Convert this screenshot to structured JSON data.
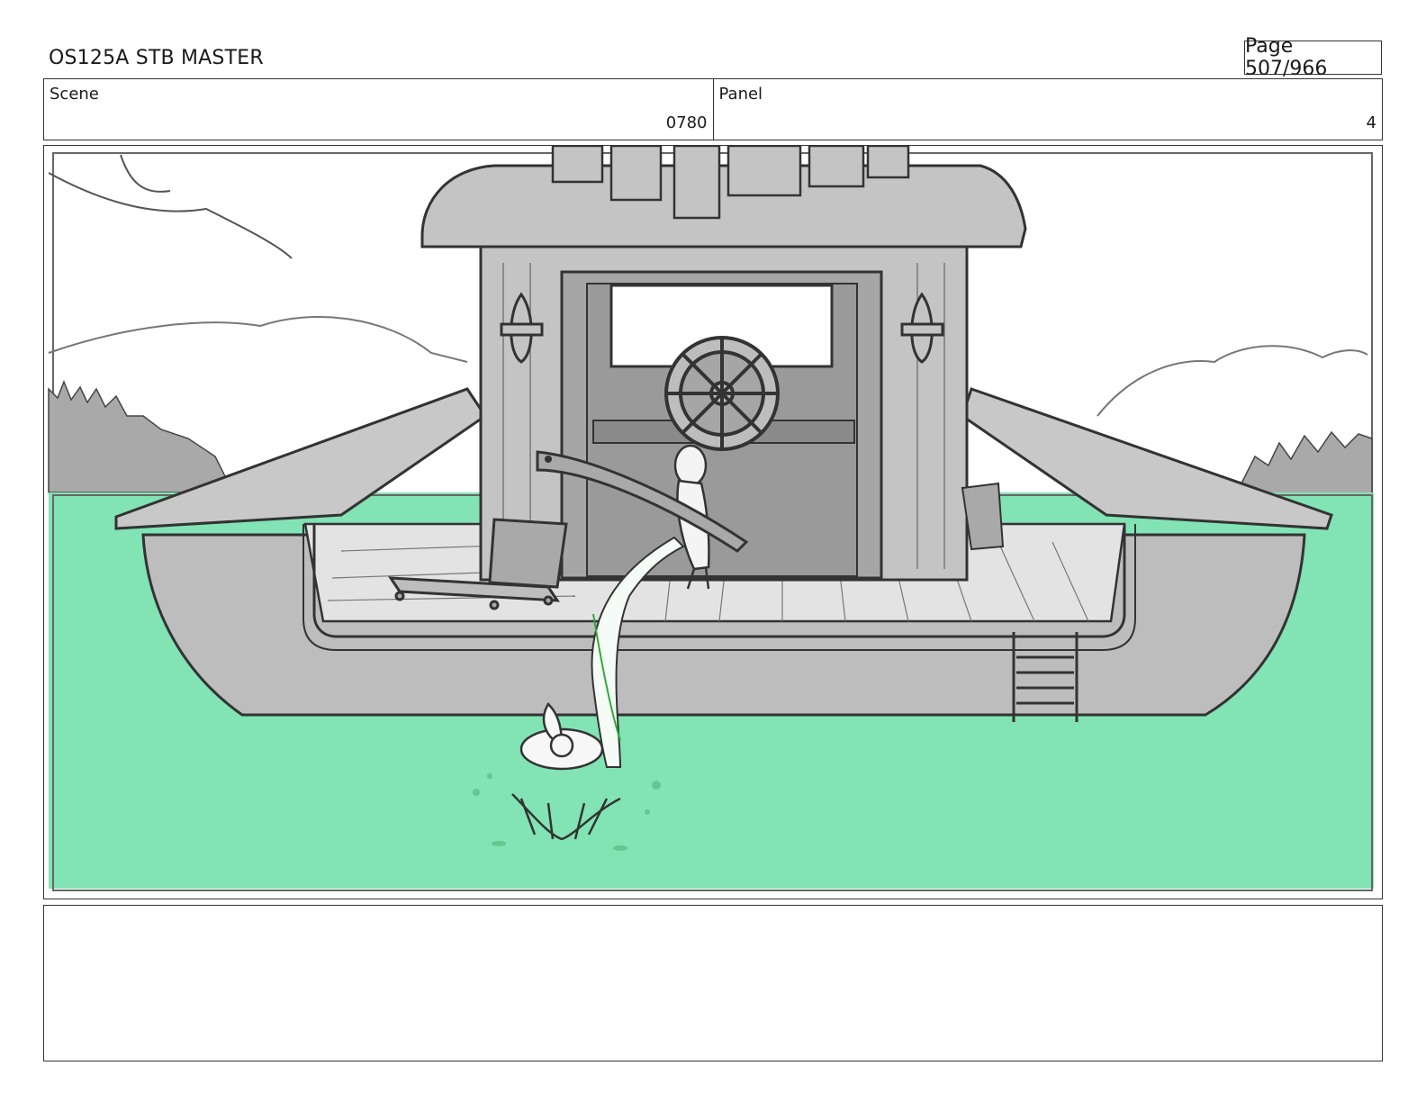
{
  "header": {
    "doc_title": "OS125A STB MASTER",
    "page_label": "Page 507/966"
  },
  "info": {
    "scene_label": "Scene",
    "scene_value": "0780",
    "panel_label": "Panel",
    "panel_value": "4"
  },
  "artwork": {
    "subject": "boat-with-wheelhouse",
    "colors": {
      "water": "#82e3b4",
      "boat_gray": "#bdbdbd",
      "boat_dark": "#8f8f8f",
      "line": "#333333",
      "sky": "#ffffff",
      "splash": "#5fc98e"
    }
  },
  "notes": {
    "text": ""
  }
}
